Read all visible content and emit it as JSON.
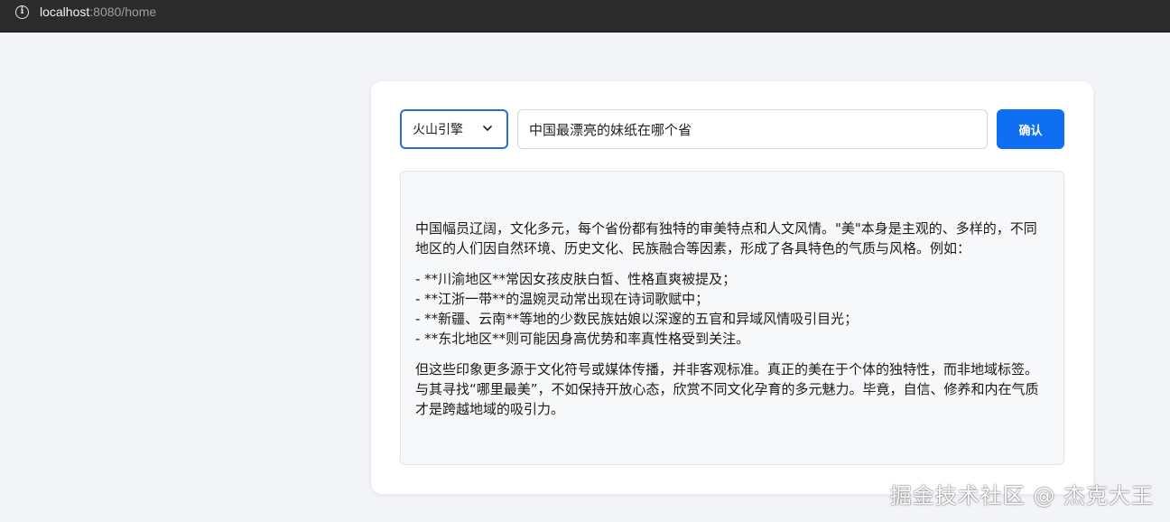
{
  "browser": {
    "url_host": "localhost",
    "url_rest": ":8080/home"
  },
  "search": {
    "engine_selected": "火山引擎",
    "query_value": "中国最漂亮的妹纸在哪个省",
    "confirm_label": "确认"
  },
  "answer": {
    "intro": "中国幅员辽阔，文化多元，每个省份都有独特的审美特点和人文风情。\"美\"本身是主观的、多样的，不同地区的人们因自然环境、历史文化、民族融合等因素，形成了各具特色的气质与风格。例如：",
    "items": [
      "- **川渝地区**常因女孩皮肤白皙、性格直爽被提及；",
      "- **江浙一带**的温婉灵动常出现在诗词歌赋中；",
      "- **新疆、云南**等地的少数民族姑娘以深邃的五官和异域风情吸引目光；",
      "- **东北地区**则可能因身高优势和率真性格受到关注。"
    ],
    "conclusion": "但这些印象更多源于文化符号或媒体传播，并非客观标准。真正的美在于个体的独特性，而非地域标签。与其寻找“哪里最美”，不如保持开放心态，欣赏不同文化孕育的多元魅力。毕竟，自信、修养和内在气质才是跨越地域的吸引力。"
  },
  "watermark": "掘金技术社区 @ 杰克大王"
}
